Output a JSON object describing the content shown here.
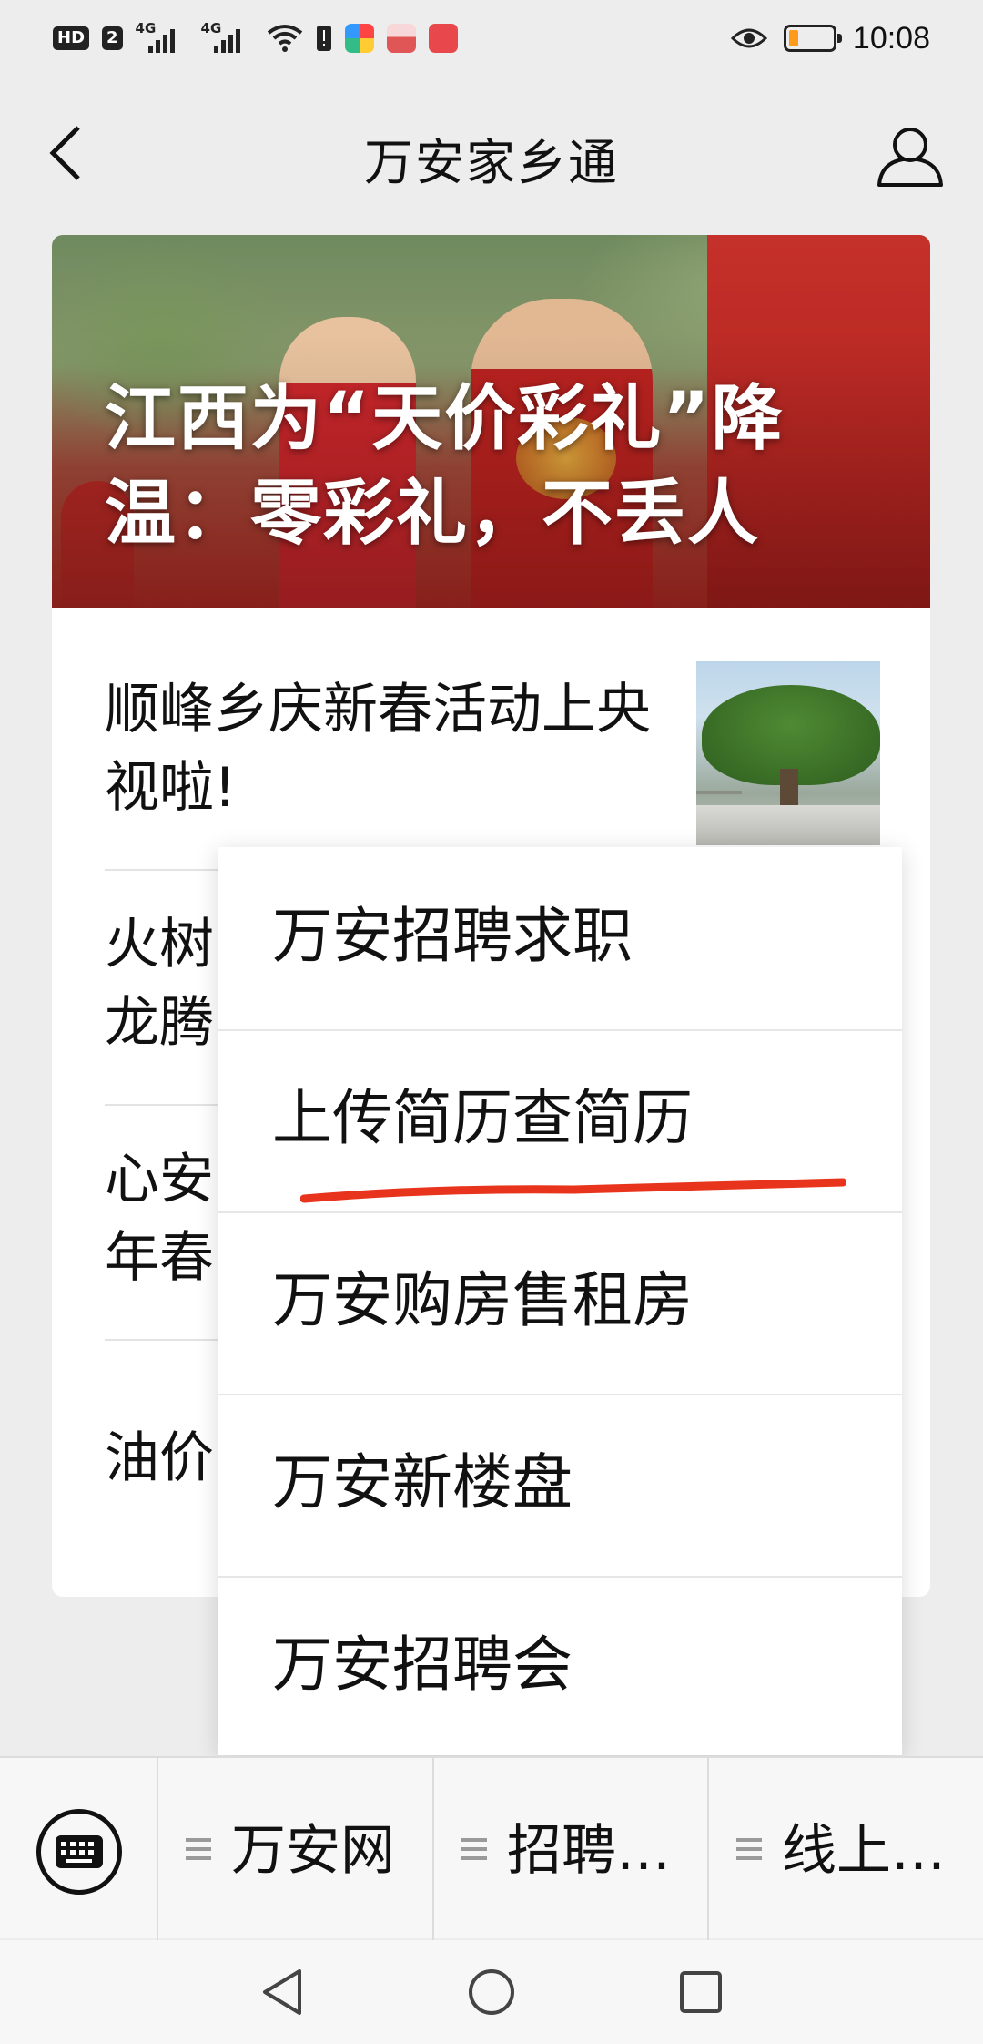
{
  "status_bar": {
    "hd_badge": "HD",
    "sim_slot": "2",
    "network_1": "4G",
    "network_2": "4G",
    "battery_level": 0.2,
    "time": "10:08"
  },
  "header": {
    "title": "万安家乡通",
    "back_icon": "chevron-left-icon",
    "profile_icon": "person-icon"
  },
  "article": {
    "hero_title": "江西为“天价彩礼”降温：零彩礼，不丢人",
    "items": [
      {
        "title": "顺峰乡庆新春活动上央视啦!"
      },
      {
        "title": "火树"
      },
      {
        "title": "龙腾"
      },
      {
        "title": "心安"
      },
      {
        "title": "年春"
      },
      {
        "title": "油价"
      }
    ]
  },
  "popup_menu": {
    "items": [
      {
        "label": "万安招聘求职"
      },
      {
        "label": "上传简历查简历"
      },
      {
        "label": "万安购房售租房"
      },
      {
        "label": "万安新楼盘"
      },
      {
        "label": "万安招聘会"
      }
    ],
    "highlighted_index": 1,
    "underline_color": "#e8341c"
  },
  "bottom_menu": {
    "keyboard_icon": "keyboard-icon",
    "tabs": [
      {
        "label": "万安网"
      },
      {
        "label": "招聘…"
      },
      {
        "label": "线上…"
      }
    ]
  },
  "system_nav": {
    "back": "triangle-back-icon",
    "home": "circle-home-icon",
    "recents": "square-recents-icon"
  }
}
